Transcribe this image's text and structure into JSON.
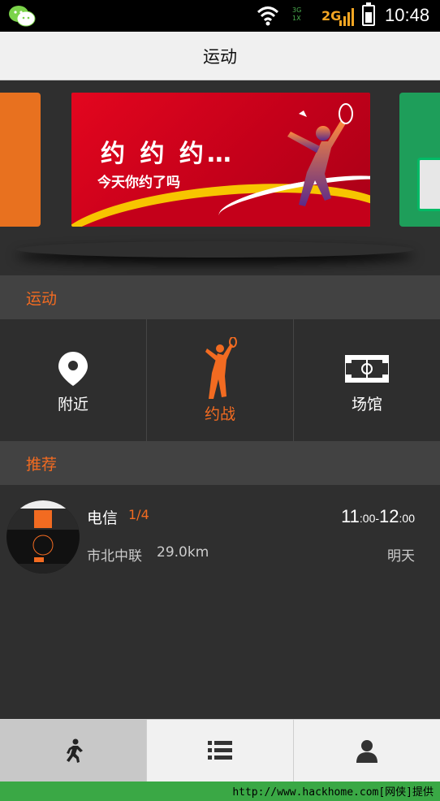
{
  "statusbar": {
    "time": "10:48",
    "net_3g": "3G",
    "net_1x": "1X",
    "net_2g": "2G"
  },
  "header": {
    "title": "运动"
  },
  "banner": {
    "headline": "约 约 约…",
    "subline": "今天你约了吗"
  },
  "sections": {
    "sports": "运动",
    "recommend": "推荐"
  },
  "grid": [
    {
      "label": "附近",
      "icon": "location-pin-icon"
    },
    {
      "label": "约战",
      "icon": "badminton-player-icon"
    },
    {
      "label": "场馆",
      "icon": "court-icon"
    }
  ],
  "recommendation": {
    "name": "电信",
    "count": "1/4",
    "place": "市北中联",
    "distance": "29.0km",
    "start_hour": "11",
    "start_min": ":00",
    "sep": "-",
    "end_hour": "12",
    "end_min": ":00",
    "day": "明天"
  },
  "tabs": [
    {
      "icon": "runner-icon",
      "active": true
    },
    {
      "icon": "list-icon",
      "active": false
    },
    {
      "icon": "user-icon",
      "active": false
    }
  ],
  "footer": {
    "text": "http://www.hackhome.com[网侠]提供"
  },
  "colors": {
    "accent": "#f26b21",
    "banner_red": "#e3061e",
    "footer_green": "#3aa845"
  }
}
